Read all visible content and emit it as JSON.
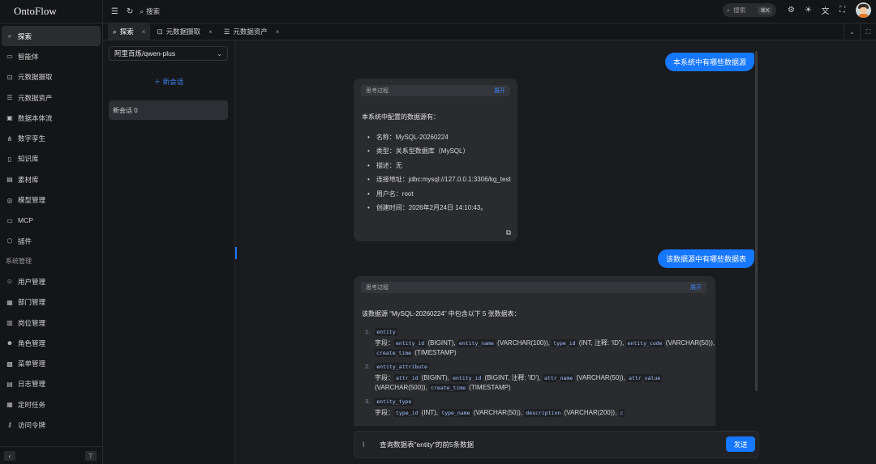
{
  "app": {
    "title": "OntoFlow"
  },
  "sidebar": {
    "items": [
      {
        "label": "探索",
        "icon": "search-icon"
      },
      {
        "label": "智能体",
        "icon": "agent-icon"
      },
      {
        "label": "元数据摄取",
        "icon": "ingest-icon"
      },
      {
        "label": "元数据资产",
        "icon": "database-icon"
      },
      {
        "label": "数据本体流",
        "icon": "flow-icon"
      },
      {
        "label": "数字孪生",
        "icon": "twin-icon"
      },
      {
        "label": "知识库",
        "icon": "book-icon"
      },
      {
        "label": "素材库",
        "icon": "folder-icon"
      },
      {
        "label": "模型管理",
        "icon": "model-icon"
      },
      {
        "label": "MCP",
        "icon": "mcp-icon"
      },
      {
        "label": "插件",
        "icon": "plugin-icon"
      }
    ],
    "section_title": "系统管理",
    "admin_items": [
      {
        "label": "用户管理",
        "icon": "user-icon"
      },
      {
        "label": "部门管理",
        "icon": "department-icon"
      },
      {
        "label": "岗位管理",
        "icon": "position-icon"
      },
      {
        "label": "角色管理",
        "icon": "role-icon"
      },
      {
        "label": "菜单管理",
        "icon": "menu-icon"
      },
      {
        "label": "日志管理",
        "icon": "log-icon"
      },
      {
        "label": "定时任务",
        "icon": "calendar-icon"
      },
      {
        "label": "访问令牌",
        "icon": "key-icon"
      }
    ]
  },
  "topbar": {
    "search_label": "搜索",
    "search_box_placeholder": "搜索",
    "shortcut": "⌘K"
  },
  "tabs": [
    {
      "label": "探索",
      "icon": "search-icon"
    },
    {
      "label": "元数据摄取",
      "icon": "ingest-icon"
    },
    {
      "label": "元数据资产",
      "icon": "database-icon"
    }
  ],
  "conversation_panel": {
    "model": "阿里百炼/qwen-plus",
    "new_conversation": "新会话",
    "conversations": [
      "新会话 0"
    ]
  },
  "chat": {
    "messages": [
      {
        "role": "user",
        "text": "本系统中有哪些数据源"
      },
      {
        "role": "assistant",
        "thinking_label": "思考过程",
        "expand_label": "展开",
        "intro": "本系统中配置的数据源有：",
        "bullets": [
          "名称：MySQL-20260224",
          "类型：关系型数据库（MySQL）",
          "描述：无",
          "连接地址：jdbc:mysql://127.0.0.1:3306/kg_test",
          "用户名：root",
          "创建时间：2026年2月24日 14:10:43。"
        ]
      },
      {
        "role": "user",
        "text": "该数据源中有哪些数据表"
      },
      {
        "role": "assistant",
        "thinking_label": "思考过程",
        "expand_label": "展开",
        "intro": "该数据源 “MySQL-20260224” 中包含以下 5 张数据表：",
        "tables": [
          {
            "num": "1.",
            "name": "entity",
            "fields_label": "字段：",
            "line1": [
              {
                "code": "entity_id"
              },
              {
                "text": "(BIGINT),"
              },
              {
                "code": "entity_name"
              },
              {
                "text": "(VARCHAR(100)),"
              },
              {
                "code": "type_id"
              },
              {
                "text": "(INT, 注释: 'ID'),"
              },
              {
                "code": "entity_code"
              },
              {
                "text": "(VARCHAR(50)),"
              }
            ],
            "line2": [
              {
                "code": "create_time"
              },
              {
                "text": "(TIMESTAMP)"
              }
            ]
          },
          {
            "num": "2.",
            "name": "entity_attribute",
            "fields_label": "字段：",
            "line1": [
              {
                "code": "attr_id"
              },
              {
                "text": "(BIGINT),"
              },
              {
                "code": "entity_id"
              },
              {
                "text": "(BIGINT, 注释: 'ID'),"
              },
              {
                "code": "attr_name"
              },
              {
                "text": "(VARCHAR(50)),"
              },
              {
                "code": "attr_value"
              }
            ],
            "line2": [
              {
                "text": "(VARCHAR(500)),"
              },
              {
                "code": "create_time"
              },
              {
                "text": "(TIMESTAMP)"
              }
            ]
          },
          {
            "num": "3.",
            "name": "entity_type",
            "fields_label": "字段：",
            "line1": [
              {
                "code": "type_id"
              },
              {
                "text": "(INT),"
              },
              {
                "code": "type_name"
              },
              {
                "text": "(VARCHAR(50)),"
              },
              {
                "code": "description"
              },
              {
                "text": "(VARCHAR(200)),"
              },
              {
                "code": "c"
              }
            ],
            "line2": []
          }
        ]
      }
    ],
    "input_value": "查询数据表\"entity\"的前5条数据",
    "send_label": "发送"
  },
  "colors": {
    "accent": "#1677ff",
    "background": "#1a1b1e",
    "sidebar": "#141517"
  }
}
